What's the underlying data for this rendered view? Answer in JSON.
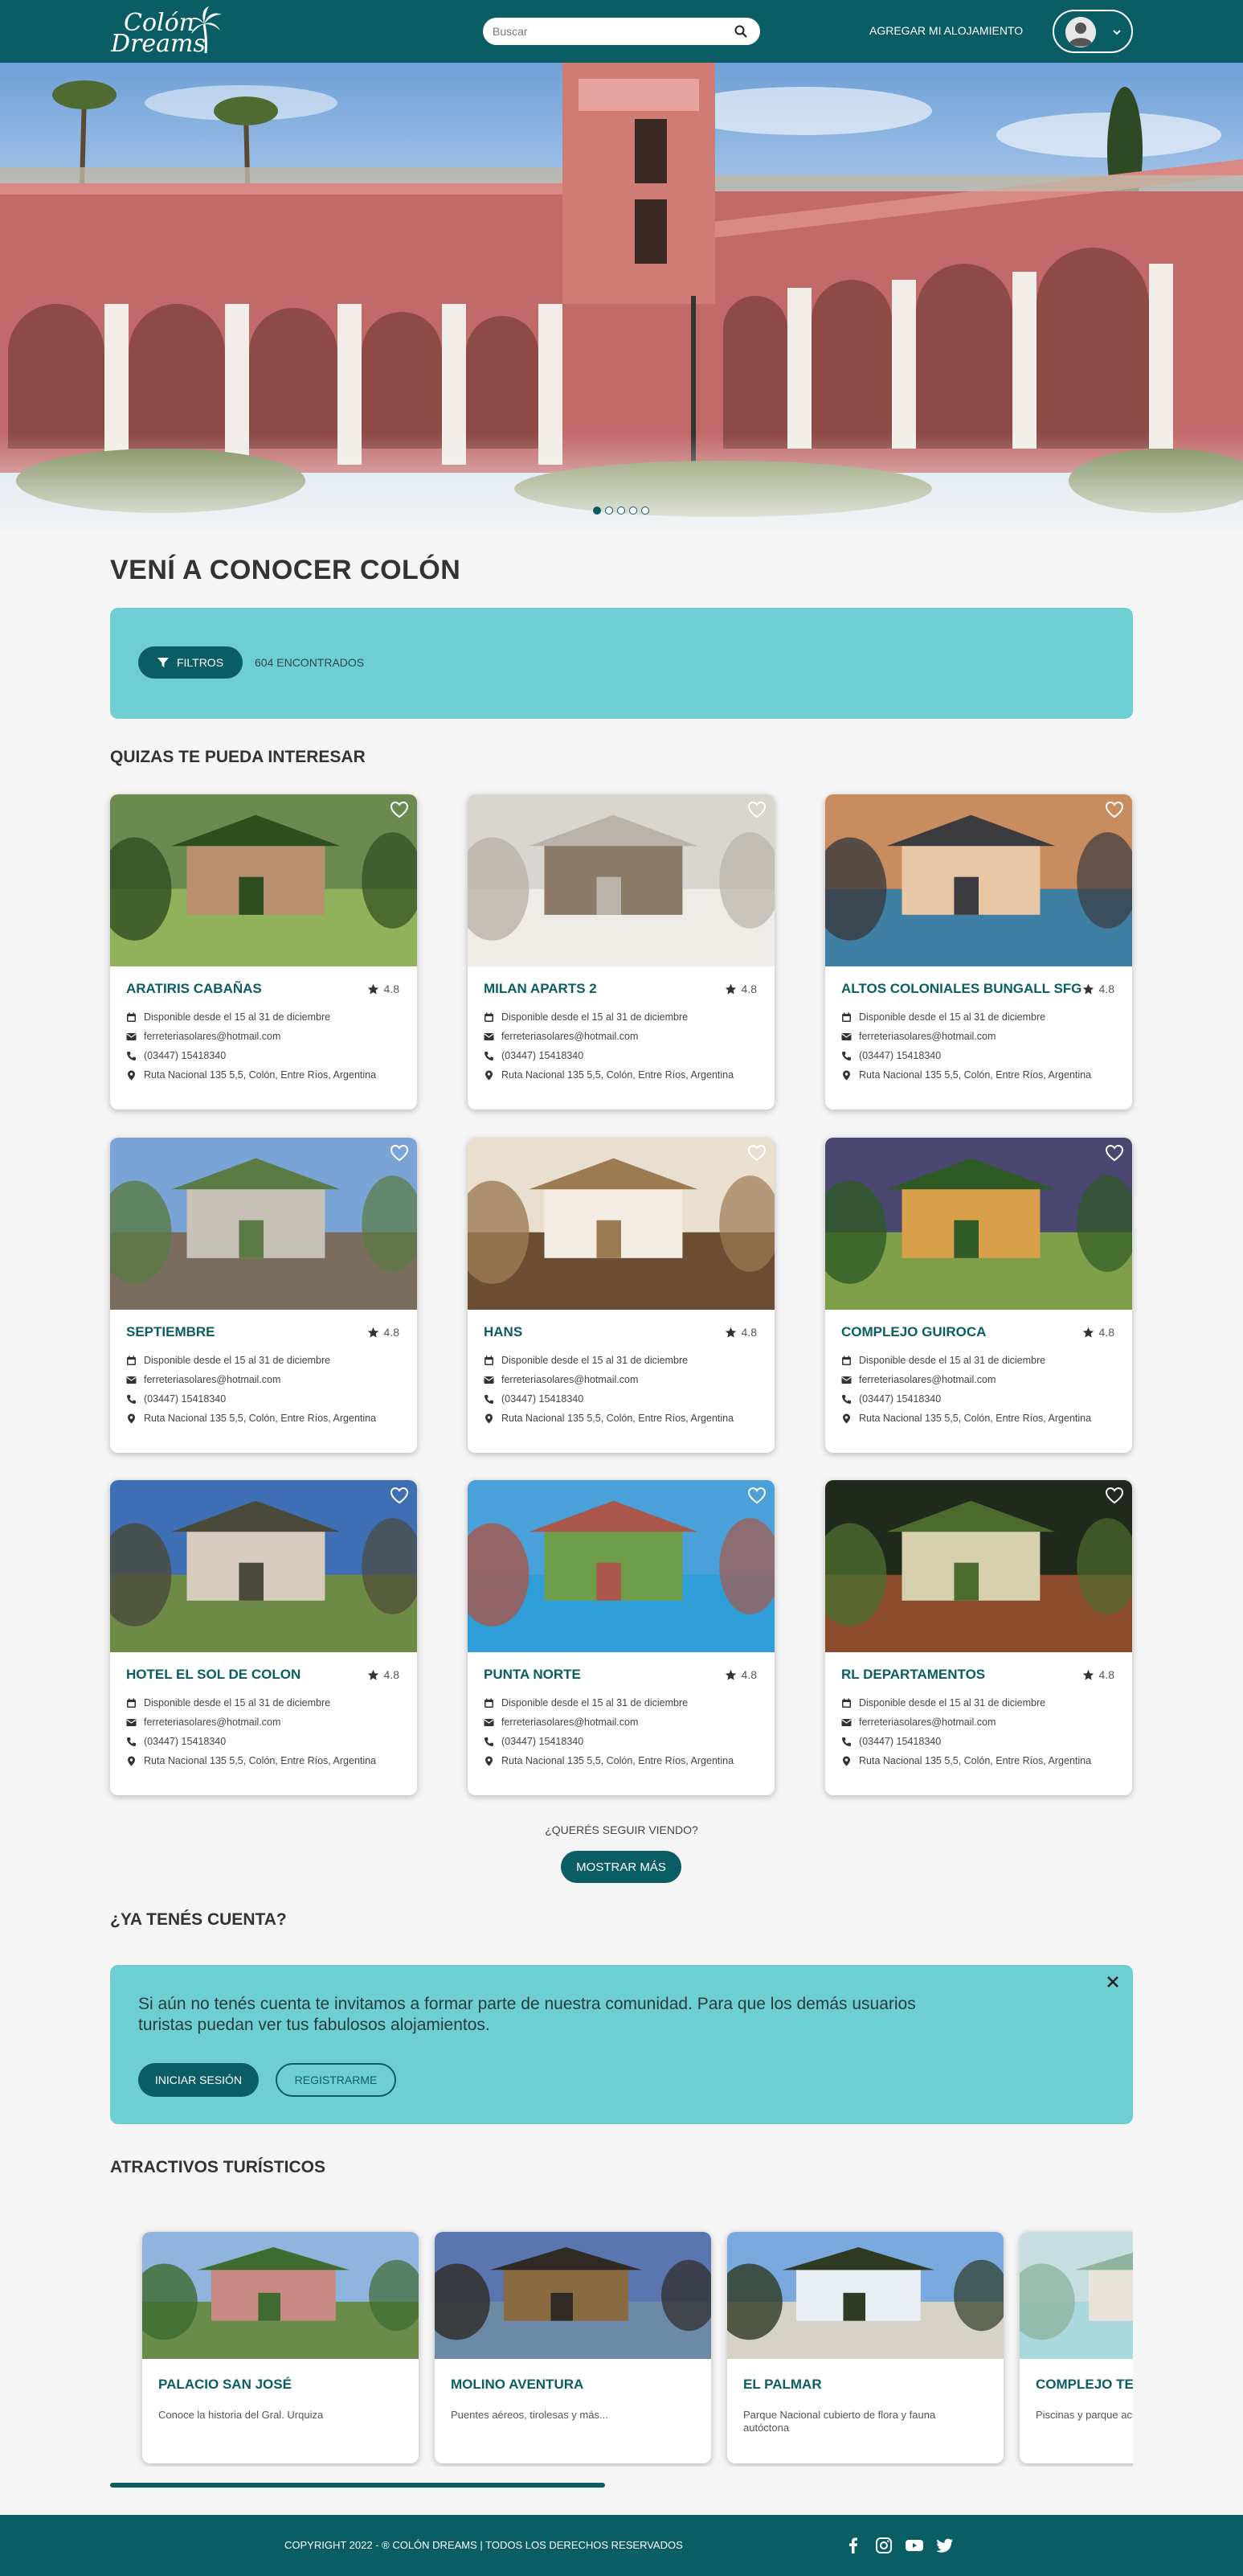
{
  "header": {
    "logo_line1": "Colón",
    "logo_line2": "Dreams",
    "search_placeholder": "Buscar",
    "add_listing": "AGREGAR MI ALOJAMIENTO"
  },
  "hero": {
    "slides": 5,
    "active_slide": 1
  },
  "page_title": "VENÍ A CONOCER COLÓN",
  "filters": {
    "button": "FILTROS",
    "found": "604 ENCONTRADOS"
  },
  "section_interest": "QUIZAS TE PUEDA INTERESAR",
  "listings": [
    {
      "name": "ARATIRIS CABAÑAS",
      "rating": "4.8",
      "availability": "Disponible desde el 15 al 31 de diciembre",
      "email": "ferreteriasolares@hotmail.com",
      "phone": "(03447) 15418340",
      "address": "Ruta Nacional 135 5,5, Colón, Entre Ríos, Argentina"
    },
    {
      "name": "MILAN APARTS 2",
      "rating": "4.8",
      "availability": "Disponible desde el 15 al 31 de diciembre",
      "email": "ferreteriasolares@hotmail.com",
      "phone": "(03447) 15418340",
      "address": "Ruta Nacional 135 5,5, Colón, Entre Ríos, Argentina"
    },
    {
      "name": "ALTOS COLONIALES BUNGALL SFG",
      "rating": "4.8",
      "availability": "Disponible desde el 15 al 31 de diciembre",
      "email": "ferreteriasolares@hotmail.com",
      "phone": "(03447) 15418340",
      "address": "Ruta Nacional 135 5,5, Colón, Entre Ríos, Argentina"
    },
    {
      "name": "SEPTIEMBRE",
      "rating": "4.8",
      "availability": "Disponible desde el 15 al 31 de diciembre",
      "email": "ferreteriasolares@hotmail.com",
      "phone": "(03447) 15418340",
      "address": "Ruta Nacional 135 5,5, Colón, Entre Ríos, Argentina"
    },
    {
      "name": "HANS",
      "rating": "4.8",
      "availability": "Disponible desde el 15 al 31 de diciembre",
      "email": "ferreteriasolares@hotmail.com",
      "phone": "(03447) 15418340",
      "address": "Ruta Nacional 135 5,5, Colón, Entre Ríos, Argentina"
    },
    {
      "name": "COMPLEJO GUIROCA",
      "rating": "4.8",
      "availability": "Disponible desde el 15 al 31 de diciembre",
      "email": "ferreteriasolares@hotmail.com",
      "phone": "(03447) 15418340",
      "address": "Ruta Nacional 135 5,5, Colón, Entre Ríos, Argentina"
    },
    {
      "name": "HOTEL EL SOL DE COLON",
      "rating": "4.8",
      "availability": "Disponible desde el 15 al 31 de diciembre",
      "email": "ferreteriasolares@hotmail.com",
      "phone": "(03447) 15418340",
      "address": "Ruta Nacional 135 5,5, Colón, Entre Ríos, Argentina"
    },
    {
      "name": "PUNTA NORTE",
      "rating": "4.8",
      "availability": "Disponible desde el 15 al 31 de diciembre",
      "email": "ferreteriasolares@hotmail.com",
      "phone": "(03447) 15418340",
      "address": "Ruta Nacional 135 5,5, Colón, Entre Ríos, Argentina"
    },
    {
      "name": "RL DEPARTAMENTOS",
      "rating": "4.8",
      "availability": "Disponible desde el 15 al 31 de diciembre",
      "email": "ferreteriasolares@hotmail.com",
      "phone": "(03447) 15418340",
      "address": "Ruta Nacional 135 5,5, Colón, Entre Ríos, Argentina"
    }
  ],
  "more": {
    "question": "¿QUERÉS SEGUIR VIENDO?",
    "button": "MOSTRAR MÁS"
  },
  "account": {
    "title": "¿YA TENÉS CUENTA?",
    "text": "Si aún no tenés cuenta te invitamos a formar parte de nuestra comunidad. Para que los demás usuarios turistas puedan ver tus fabulosos alojamientos.",
    "login": "INICIAR SESIÓN",
    "register": "REGISTRARME"
  },
  "attractions": {
    "title": "ATRACTIVOS TURÍSTICOS",
    "items": [
      {
        "name": "PALACIO SAN JOSÉ",
        "desc": "Conoce la historia del Gral. Urquiza"
      },
      {
        "name": "MOLINO AVENTURA",
        "desc": "Puentes aéreos, tirolesas y más..."
      },
      {
        "name": "EL PALMAR",
        "desc": "Parque Nacional cubierto de flora y fauna autóctona"
      },
      {
        "name": "COMPLEJO TERMAL",
        "desc": "Piscinas y parque acuático"
      }
    ]
  },
  "footer": {
    "copyright": "COPYRIGHT 2022 - ® COLÓN DREAMS | TODOS LOS DERECHOS RESERVADOS"
  },
  "colors": {
    "primary": "#0a5e63",
    "accent": "#6ecfd3",
    "background": "#f5f5f5"
  }
}
